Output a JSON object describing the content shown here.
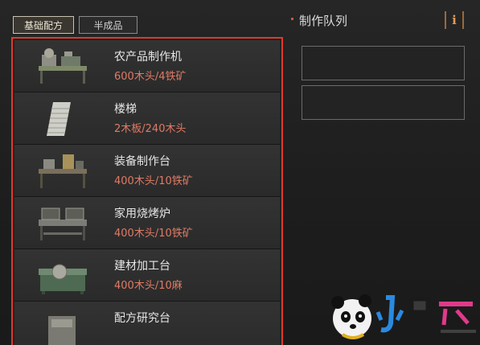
{
  "tabs": [
    {
      "label": "基础配方",
      "active": true
    },
    {
      "label": "半成品",
      "active": false
    }
  ],
  "recipes": [
    {
      "name": "农产品制作机",
      "cost": "600木头/4铁矿",
      "icon": "farm-machine-icon"
    },
    {
      "name": "楼梯",
      "cost": "2木板/240木头",
      "icon": "stairs-icon"
    },
    {
      "name": "装备制作台",
      "cost": "400木头/10铁矿",
      "icon": "equipment-workbench-icon"
    },
    {
      "name": "家用烧烤炉",
      "cost": "400木头/10铁矿",
      "icon": "bbq-grill-icon"
    },
    {
      "name": "建材加工台",
      "cost": "400木头/10麻",
      "icon": "material-workbench-icon"
    },
    {
      "name": "配方研究台",
      "cost": "",
      "icon": "research-table-icon"
    }
  ],
  "queue": {
    "title": "制作队列",
    "info_label": "i",
    "slots": 2
  },
  "watermark": {
    "text": "小黑游戏",
    "url": "www.xiaohei.com"
  },
  "colors": {
    "highlight_border": "#e03a2a",
    "cost_text": "#e07a64",
    "accent": "#e09a5a"
  }
}
